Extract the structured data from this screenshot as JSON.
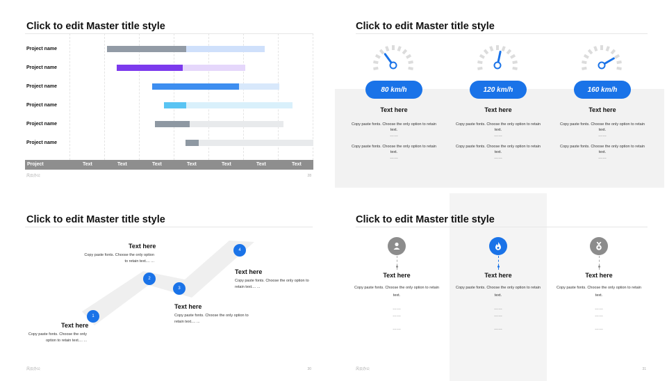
{
  "slide1": {
    "title": "Click to edit Master title style",
    "rows": [
      {
        "label": "Project name",
        "planned": [
          0.155,
          0.8
        ],
        "actual": [
          0.155,
          0.48
        ],
        "color": "#929ba6",
        "light": "#cfe0fb"
      },
      {
        "label": "Project name",
        "planned": [
          0.195,
          0.72
        ],
        "actual": [
          0.195,
          0.465
        ],
        "color": "#7c3aed",
        "light": "#e5d7fb"
      },
      {
        "label": "Project name",
        "planned": [
          0.338,
          0.86
        ],
        "actual": [
          0.338,
          0.694
        ],
        "color": "#3d8ef0",
        "light": "#d8e8fb"
      },
      {
        "label": "Project name",
        "planned": [
          0.388,
          0.915
        ],
        "actual": [
          0.388,
          0.478
        ],
        "color": "#59c4f3",
        "light": "#d9f0fb"
      },
      {
        "label": "Project name",
        "planned": [
          0.35,
          0.878
        ],
        "actual": [
          0.35,
          0.494
        ],
        "color": "#8e98a2",
        "light": "#e8eaec"
      },
      {
        "label": "Project name",
        "planned": [
          0.476,
          1.0
        ],
        "actual": [
          0.476,
          0.53
        ],
        "color": "#8e98a2",
        "light": "#e8eaec"
      }
    ],
    "axis": [
      "Project",
      "Text",
      "Text",
      "Text",
      "Text",
      "Text",
      "Text",
      "Text"
    ],
    "footer": "风云办公",
    "page": "28"
  },
  "slide2": {
    "title": "Click to edit Master title style",
    "columns": [
      {
        "speed": "80 km/h",
        "level": 0.35,
        "heading": "Text here",
        "text1": "Copy paste fonts. Choose the only option to retain text.",
        "text2": "Copy paste fonts. Choose the only option to retain text.",
        "dots1": "……",
        "dots2": "……"
      },
      {
        "speed": "120 km/h",
        "level": 0.55,
        "heading": "Text here",
        "text1": "Copy paste fonts. Choose the only option to retain text.",
        "text2": "Copy paste fonts. Choose the only option to retain text.",
        "dots1": "……",
        "dots2": "……"
      },
      {
        "speed": "160 km/h",
        "level": 0.75,
        "heading": "Text here",
        "text1": "Copy paste fonts. Choose the only option to retain text.",
        "text2": "Copy paste fonts. Choose the only option to retain text.",
        "dots1": "……",
        "dots2": "……"
      }
    ],
    "accent": "#1a73e8"
  },
  "slide3": {
    "title": "Click to edit Master title style",
    "steps": [
      {
        "num": "1",
        "heading": "Text here",
        "text": "Copy paste fonts. Choose the only option to retain text.... ..."
      },
      {
        "num": "2",
        "heading": "Text here",
        "text": "Copy paste fonts. Choose the only option to retain text.... ..."
      },
      {
        "num": "3",
        "heading": "Text here",
        "text": "Copy paste fonts. Choose the only option to retain text.... ..."
      },
      {
        "num": "4",
        "heading": "Text here",
        "text": "Copy paste fonts. Choose the only option to retain text.... ..."
      }
    ],
    "footer": "风云办公",
    "page": "30"
  },
  "slide4": {
    "title": "Click to edit Master title style",
    "columns": [
      {
        "icon": "user-location-icon",
        "heading": "Text here",
        "text": "Copy paste fonts. Choose the only option to retain text.",
        "dots": [
          "……",
          "……",
          "……"
        ]
      },
      {
        "icon": "flame-icon",
        "heading": "Text here",
        "text": "Copy paste fonts. Choose the only option to retain text.",
        "dots": [
          "……",
          "……",
          "……"
        ]
      },
      {
        "icon": "medal-icon",
        "heading": "Text here",
        "text": "Copy paste fonts. Choose the only option to retain text.",
        "dots": [
          "……",
          "……",
          "……"
        ]
      }
    ],
    "footer": "风云办公",
    "page": "31",
    "accent": "#1a73e8",
    "muted": "#8c8c8c"
  }
}
